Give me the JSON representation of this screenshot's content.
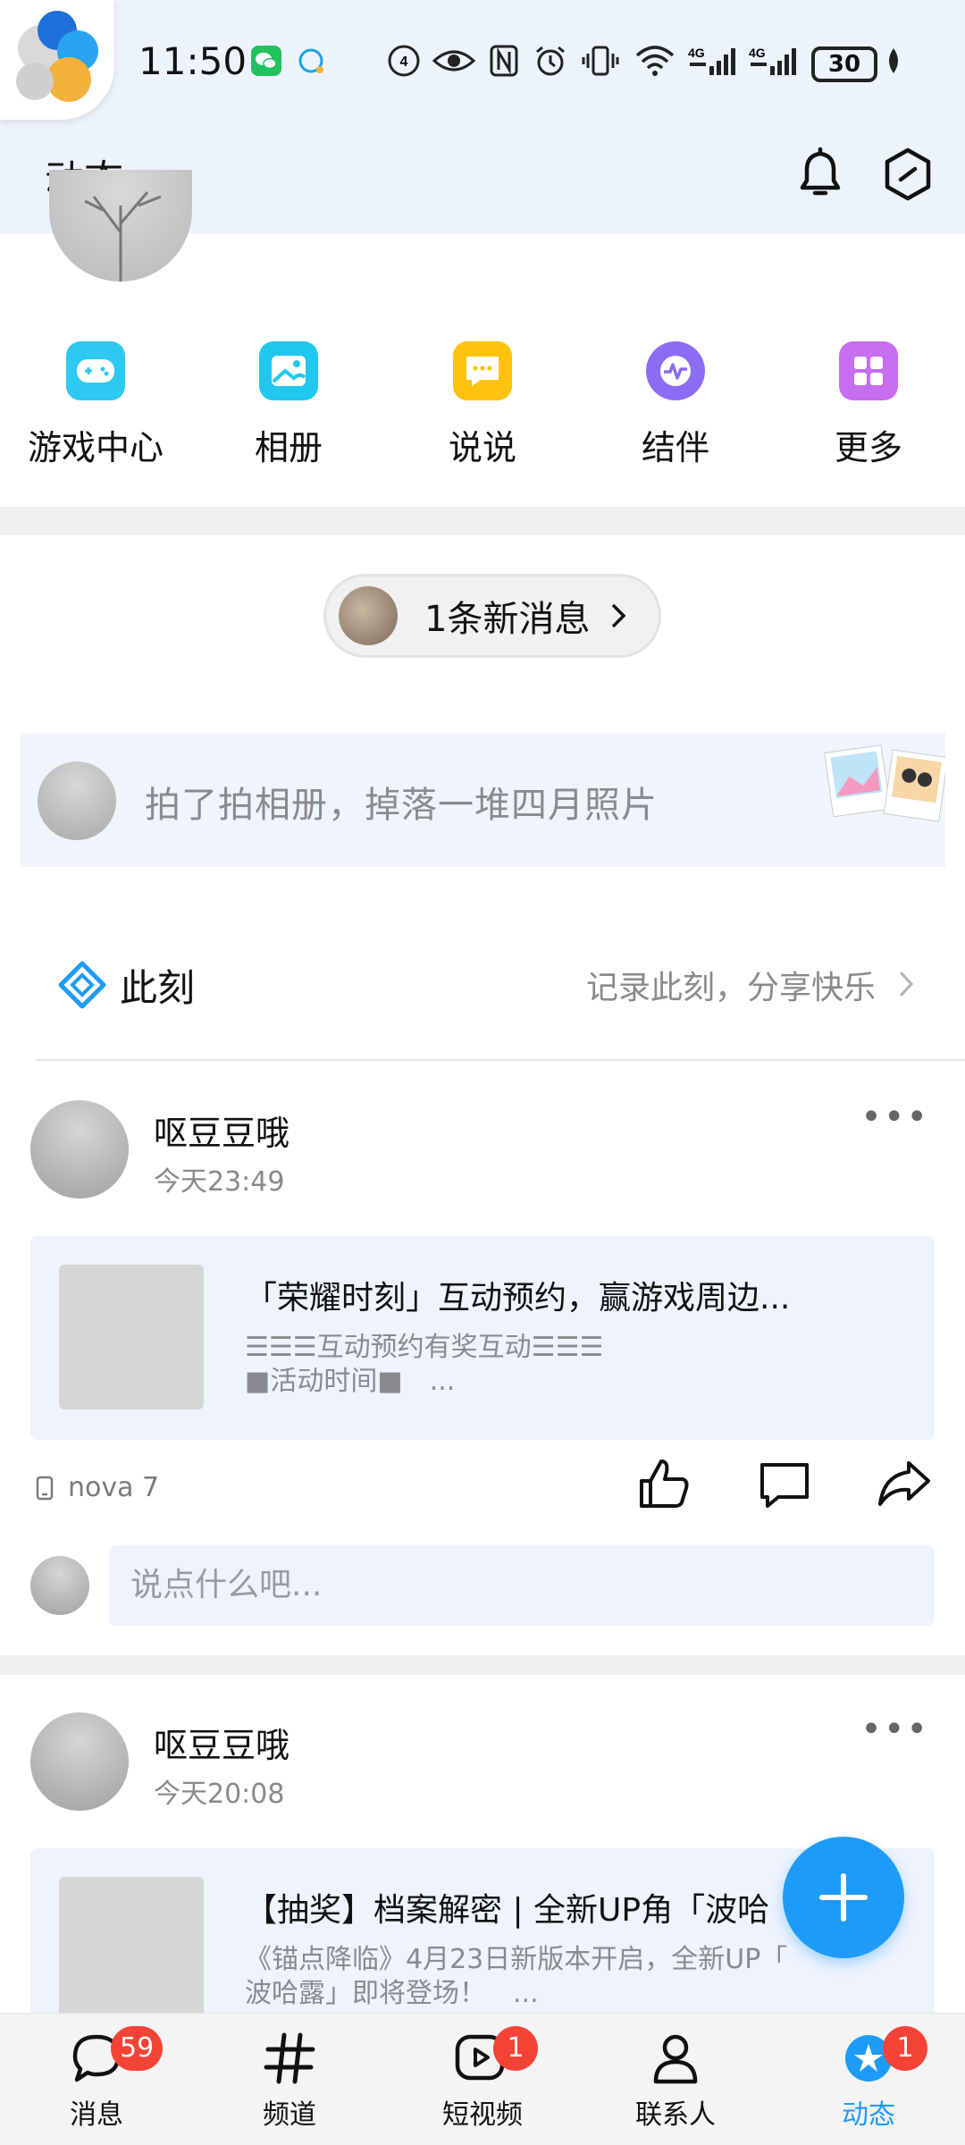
{
  "status_bar": {
    "time": "11:50",
    "battery": "30",
    "icons": [
      "wechat-icon",
      "chat-bubble-icon",
      "hd-icon",
      "eye-icon",
      "nfc-icon",
      "alarm-icon",
      "vibrate-icon",
      "wifi-icon",
      "signal-4g-icon",
      "signal-4g-icon",
      "leaf-icon"
    ]
  },
  "header": {
    "title": "动态",
    "icons": [
      "bell-icon",
      "hexagon-settings-icon"
    ]
  },
  "shortcuts": [
    {
      "label": "游戏中心",
      "icon": "gamepad-icon",
      "color": "#2ec9f0"
    },
    {
      "label": "相册",
      "icon": "photo-album-icon",
      "color": "#20c8ef"
    },
    {
      "label": "说说",
      "icon": "speech-bubble-icon",
      "color": "#ffc20e"
    },
    {
      "label": "结伴",
      "icon": "pulse-chat-icon",
      "color": "#8b6cf2"
    },
    {
      "label": "更多",
      "icon": "grid-more-icon",
      "color": "#c76df0"
    }
  ],
  "new_message": {
    "text": "1条新消息"
  },
  "album_banner": {
    "text": "拍了拍相册，掉落一堆四月照片"
  },
  "moment": {
    "label": "此刻",
    "hint": "记录此刻，分享快乐"
  },
  "posts": [
    {
      "name": "呕豆豆哦",
      "time": "今天23:49",
      "card_title": "「荣耀时刻」互动预约，赢游戏周边...",
      "card_desc_line1": "☰☰☰互动预约有奖互动☰☰☰",
      "card_desc_line2": "■活动时间■　...",
      "device": "nova 7",
      "comment_placeholder": "说点什么吧..."
    },
    {
      "name": "呕豆豆哦",
      "time": "今天20:08",
      "card_title": "【抽奖】档案解密 | 全新UP角「波哈",
      "card_desc_line1": "《锚点降临》4月23日新版本开启，全新UP「",
      "card_desc_line2": "波哈露」即将登场！　..."
    }
  ],
  "bottom_nav": [
    {
      "label": "消息",
      "icon": "message-bubble-icon",
      "badge": "59"
    },
    {
      "label": "频道",
      "icon": "hashtag-icon",
      "badge": ""
    },
    {
      "label": "短视频",
      "icon": "video-play-icon",
      "badge": "1"
    },
    {
      "label": "联系人",
      "icon": "person-icon",
      "badge": ""
    },
    {
      "label": "动态",
      "icon": "star-feed-icon",
      "badge": "1",
      "active": true
    }
  ],
  "accent_color": "#1e9bf7"
}
